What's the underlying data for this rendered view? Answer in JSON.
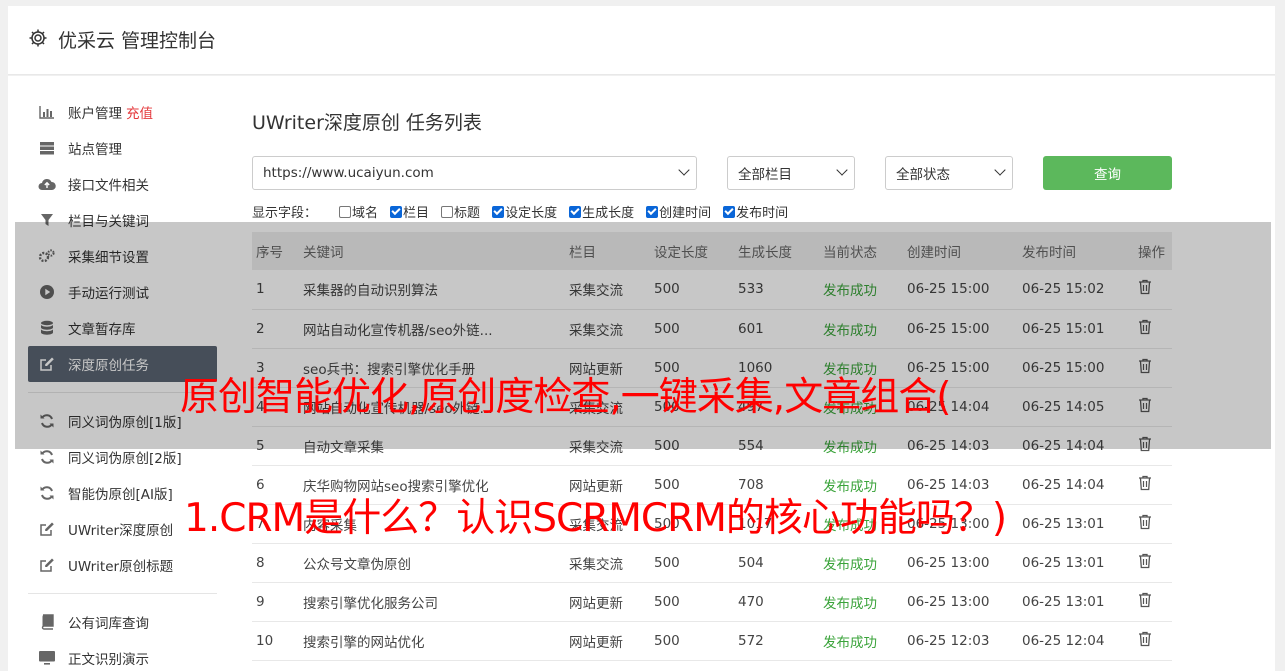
{
  "app": {
    "title": "优采云 管理控制台"
  },
  "sidebar": {
    "group1": [
      {
        "label": "账户管理",
        "extra": "充值",
        "icon": "bar-chart-icon"
      },
      {
        "label": "站点管理",
        "icon": "server-icon"
      },
      {
        "label": "接口文件相关",
        "icon": "cloud-upload-icon"
      },
      {
        "label": "栏目与关键词",
        "icon": "filter-icon"
      },
      {
        "label": "采集细节设置",
        "icon": "gears-icon"
      },
      {
        "label": "手动运行测试",
        "icon": "play-circle-icon"
      },
      {
        "label": "文章暂存库",
        "icon": "database-icon"
      },
      {
        "label": "深度原创任务",
        "icon": "edit-icon",
        "active": true
      }
    ],
    "group2": [
      {
        "label": "同义词伪原创[1版]",
        "icon": "refresh-icon"
      },
      {
        "label": "同义词伪原创[2版]",
        "icon": "refresh-icon"
      },
      {
        "label": "智能伪原创[AI版]",
        "icon": "refresh-icon"
      },
      {
        "label": "UWriter深度原创",
        "icon": "edit-icon"
      },
      {
        "label": "UWriter原创标题",
        "icon": "edit-icon"
      }
    ],
    "group3": [
      {
        "label": "公有词库查询",
        "icon": "book-icon"
      },
      {
        "label": "正文识别演示",
        "icon": "monitor-icon"
      }
    ]
  },
  "main": {
    "title": "UWriter深度原创 任务列表",
    "site_select": "https://www.ucaiyun.com",
    "column_select": "全部栏目",
    "status_select": "全部状态",
    "query_label": "查询",
    "fields_label": "显示字段：",
    "fields": [
      {
        "label": "域名",
        "checked": false
      },
      {
        "label": "栏目",
        "checked": true
      },
      {
        "label": "标题",
        "checked": false
      },
      {
        "label": "设定长度",
        "checked": true
      },
      {
        "label": "生成长度",
        "checked": true
      },
      {
        "label": "创建时间",
        "checked": true
      },
      {
        "label": "发布时间",
        "checked": true
      }
    ],
    "table": {
      "headers": [
        "序号",
        "关键词",
        "栏目",
        "设定长度",
        "生成长度",
        "当前状态",
        "创建时间",
        "发布时间",
        "操作"
      ],
      "rows": [
        [
          "1",
          "采集器的自动识别算法",
          "采集交流",
          "500",
          "533",
          "发布成功",
          "06-25 15:00",
          "06-25 15:02"
        ],
        [
          "2",
          "网站自动化宣传机器/seo外链...",
          "采集交流",
          "500",
          "601",
          "发布成功",
          "06-25 15:00",
          "06-25 15:01"
        ],
        [
          "3",
          "seo兵书：搜索引擎优化手册",
          "网站更新",
          "500",
          "1060",
          "发布成功",
          "06-25 15:00",
          "06-25 15:00"
        ],
        [
          "4",
          "网站自动化宣传机器/seo外链...",
          "采集交流",
          "500",
          "497",
          "发布成功",
          "06-25 14:04",
          "06-25 14:05"
        ],
        [
          "5",
          "自动文章采集",
          "采集交流",
          "500",
          "554",
          "发布成功",
          "06-25 14:03",
          "06-25 14:04"
        ],
        [
          "6",
          "庆华购物网站seo搜索引擎优化",
          "网站更新",
          "500",
          "708",
          "发布成功",
          "06-25 14:03",
          "06-25 14:04"
        ],
        [
          "7",
          "内容采集",
          "采集交流",
          "500",
          "1017",
          "发布成功",
          "06-25 13:00",
          "06-25 13:01"
        ],
        [
          "8",
          "公众号文章伪原创",
          "采集交流",
          "500",
          "504",
          "发布成功",
          "06-25 13:00",
          "06-25 13:01"
        ],
        [
          "9",
          "搜索引擎优化服务公司",
          "网站更新",
          "500",
          "470",
          "发布成功",
          "06-25 13:00",
          "06-25 13:01"
        ],
        [
          "10",
          "搜索引擎的网站优化",
          "网站更新",
          "500",
          "572",
          "发布成功",
          "06-25 12:03",
          "06-25 12:04"
        ]
      ]
    }
  },
  "overlay": {
    "line1": "原创智能优化,原创度检查,一键采集,文章组合(",
    "line2": "1.CRM是什么？认识SCRMCRM的核心功能吗？)"
  },
  "colors": {
    "query_button": "#5cb85c",
    "success": "#3aa33a",
    "active_nav": "#5a6472",
    "overlay_text": "#ff0000"
  }
}
